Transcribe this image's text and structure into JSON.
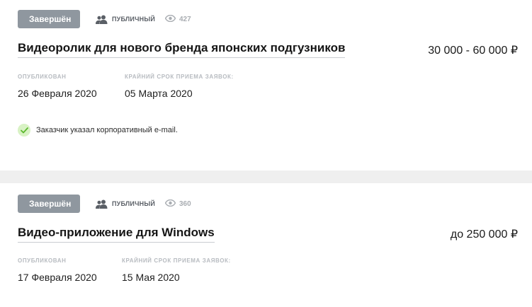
{
  "listings": [
    {
      "status": "Завершён",
      "visibility": "ПУБЛИЧНЫЙ",
      "visibility_icon": "users-icon",
      "views_icon": "eye-icon",
      "views": "427",
      "title": "Видеоролик для нового бренда японских подгузников",
      "budget": "30 000 - 60 000 ₽",
      "published_label": "ОПУБЛИКОВАН",
      "published_date": "26 Февраля 2020",
      "deadline_label": "КРАЙНИЙ СРОК ПРИЕМА ЗАЯВОК:",
      "deadline_date": "05 Марта 2020",
      "note": "Заказчик указал корпоративный e-mail."
    },
    {
      "status": "Завершён",
      "visibility": "ПУБЛИЧНЫЙ",
      "visibility_icon": "users-icon",
      "views_icon": "eye-icon",
      "views": "360",
      "title": "Видео-приложение для Windows",
      "budget": "до 250 000 ₽",
      "published_label": "ОПУБЛИКОВАН",
      "published_date": "17 Февраля 2020",
      "deadline_label": "КРАЙНИЙ СРОК ПРИЕМА ЗАЯВОК:",
      "deadline_date": "15 Мая 2020"
    }
  ],
  "colors": {
    "status_bg": "#8f979f",
    "check_bg": "#d8f2c4",
    "check_mark": "#5cb82e",
    "divider": "#efefef"
  }
}
